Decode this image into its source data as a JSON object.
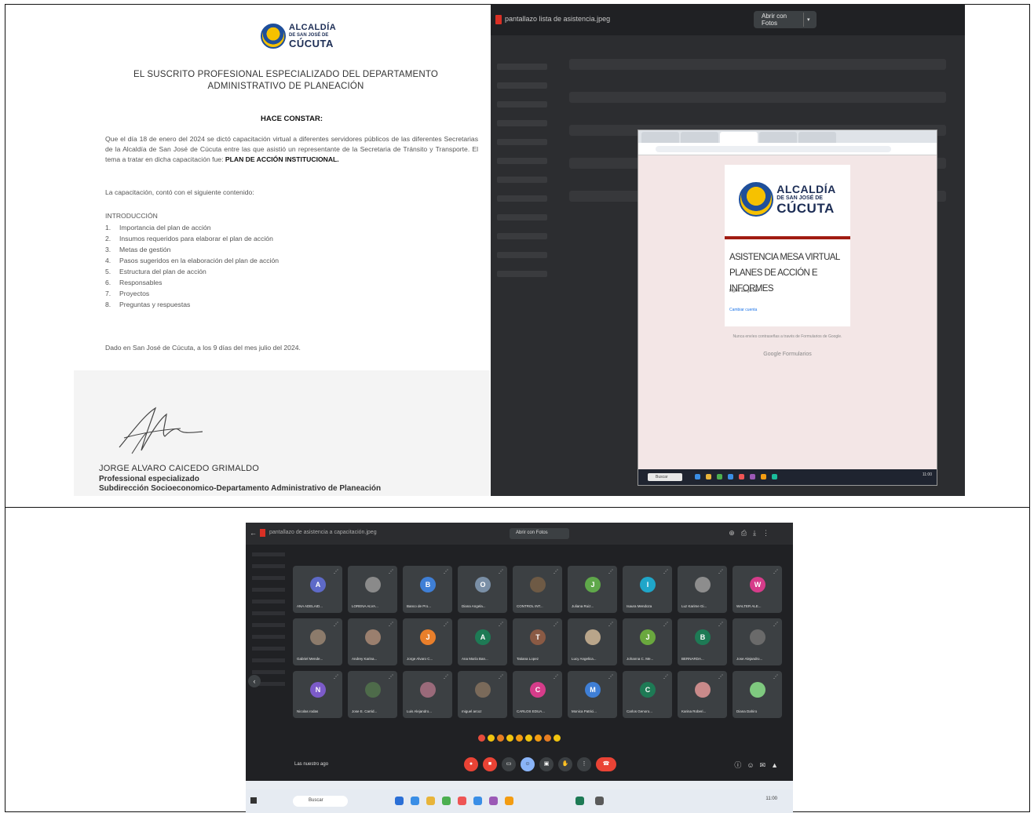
{
  "certificate": {
    "logo": {
      "line1": "ALCALDÍA",
      "line2": "DE SAN JOSÉ DE",
      "line3": "CÚCUTA"
    },
    "heading": "EL SUSCRITO PROFESIONAL ESPECIALIZADO DEL DEPARTAMENTO ADMINISTRATIVO DE PLANEACIÓN",
    "subheading": "HACE CONSTAR:",
    "body": "Que el día 18 de enero del 2024 se dictó capacitación virtual a diferentes servidores públicos de las diferentes Secretarias de la Alcaldía de San José de Cúcuta entre las que asistió un representante de la Secretaria de Tránsito y Transporte. El tema a tratar en dicha capacitación fue:",
    "body_bold": "PLAN DE ACCIÓN INSTITUCIONAL.",
    "intro": "La capacitación, contó con el siguiente contenido:",
    "toc_title": "INTRODUCCIÓN",
    "toc": [
      {
        "num": "1.",
        "text": "Importancia del plan de acción"
      },
      {
        "num": "2.",
        "text": "Insumos requeridos para elaborar el plan de acción"
      },
      {
        "num": "3.",
        "text": "Metas de gestión"
      },
      {
        "num": "4.",
        "text": "Pasos sugeridos en la elaboración del plan de acción"
      },
      {
        "num": "5.",
        "text": "Estructura del plan de acción"
      },
      {
        "num": "6.",
        "text": "Responsables"
      },
      {
        "num": "7.",
        "text": "Proyectos"
      },
      {
        "num": "8.",
        "text": "Preguntas y respuestas"
      }
    ],
    "date_line": "Dado en San José de Cúcuta, a los 9 días del mes julio del 2024.",
    "signer_name": "JORGE ALVARO CAICEDO GRIMALDO",
    "signer_role": "Professional especializado",
    "signer_dept": "Subdirección Socioeconomico-Departamento Administrativo de Planeación"
  },
  "form_screenshot": {
    "file_name": "pantallazo lista de asistencia.jpeg",
    "open_button": "Abrir con Fotos",
    "form_title": "ASISTENCIA MESA VIRTUAL PLANES DE ACCIÓN E INFORMES",
    "login_text": "Inglés asegúrate",
    "switch_text": "Cambiar cuenta",
    "footer_text": "Nunca envíes contraseñas a través de Formularios de Google.",
    "gforms": "Google Formularios",
    "taskbar_search": "Buscar",
    "taskbar_time": "11:00"
  },
  "meet_screenshot": {
    "file_name": "pantallazo de asistencia a capacitación.jpeg",
    "open_button": "Abrir con Fotos",
    "participants": [
      {
        "initial": "A",
        "name": "ANA ADELAID...",
        "color": "#5e6ac8"
      },
      {
        "initial": "",
        "name": "LORENA ALVA...",
        "color": "#8a8a8a"
      },
      {
        "initial": "B",
        "name": "Banco de Pro...",
        "color": "#3f7fd6"
      },
      {
        "initial": "O",
        "name": "Diana Angela...",
        "color": "#7a8fa6"
      },
      {
        "initial": "",
        "name": "CONTROL INT...",
        "color": "#6e5a45"
      },
      {
        "initial": "J",
        "name": "Juliana Ruiz...",
        "color": "#5fa84a"
      },
      {
        "initial": "I",
        "name": "Isaura Mendoza",
        "color": "#1fa6c9"
      },
      {
        "initial": "",
        "name": "Luz Karime Gi...",
        "color": "#8d8d8d"
      },
      {
        "initial": "W",
        "name": "WALTER ALE...",
        "color": "#d63c8a"
      },
      {
        "initial": "",
        "name": "Gabriel Mende...",
        "color": "#8c7b6b"
      },
      {
        "initial": "",
        "name": "Andrey Karina...",
        "color": "#9a7f6e"
      },
      {
        "initial": "J",
        "name": "Jorge Alvaro C...",
        "color": "#e97f2b"
      },
      {
        "initial": "A",
        "name": "Ana María Ban...",
        "color": "#1e7a55"
      },
      {
        "initial": "T",
        "name": "Tatiana Lopez",
        "color": "#8a5a44"
      },
      {
        "initial": "",
        "name": "Lucy Angelica...",
        "color": "#b9a58a"
      },
      {
        "initial": "J",
        "name": "Johanna C. Me...",
        "color": "#6aa83e"
      },
      {
        "initial": "B",
        "name": "BERNARDA...",
        "color": "#1e7a55"
      },
      {
        "initial": "",
        "name": "Jose Alejandro...",
        "color": "#6a6a6a"
      },
      {
        "initial": "N",
        "name": "Nicolas rodas",
        "color": "#7c5bc9"
      },
      {
        "initial": "",
        "name": "Jose E. Carrid...",
        "color": "#4e6b4a"
      },
      {
        "initial": "",
        "name": "Luis Alejandro...",
        "color": "#9a6a7a"
      },
      {
        "initial": "",
        "name": "miguel arcoz",
        "color": "#7a6a5a"
      },
      {
        "initial": "C",
        "name": "CARLOS EDUA...",
        "color": "#d63c8a"
      },
      {
        "initial": "M",
        "name": "Monica Patrici...",
        "color": "#3f7fd6"
      },
      {
        "initial": "C",
        "name": "Carlos Genoro...",
        "color": "#1e7a55"
      },
      {
        "initial": "",
        "name": "Karina Roberi...",
        "color": "#c98a8a"
      },
      {
        "initial": "",
        "name": "Diana Dahiro",
        "color": "#7fc97f"
      }
    ],
    "meeting_time": "Las nuestro ago",
    "taskbar_search": "Buscar",
    "taskbar_time": "11:00"
  }
}
